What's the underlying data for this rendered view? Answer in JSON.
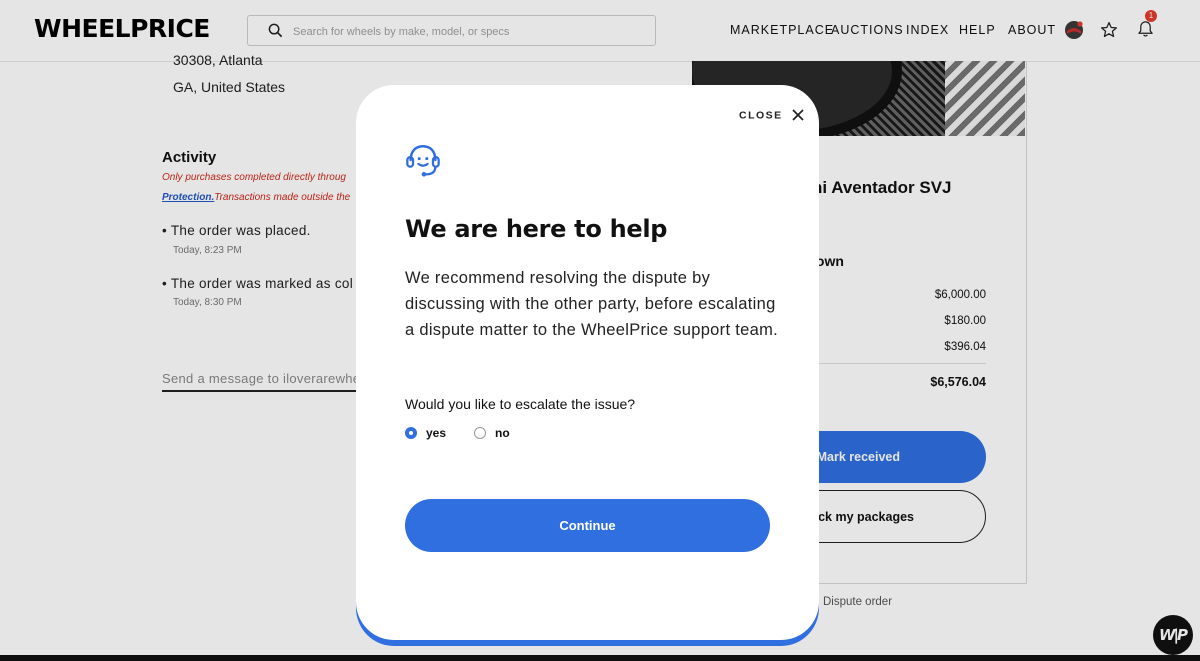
{
  "header": {
    "logo": "WHEELPRICE",
    "search_placeholder": "Search for wheels by make, model, or specs",
    "nav": [
      "MARKETPLACE",
      "AUCTIONS",
      "INDEX",
      "HELP",
      "ABOUT"
    ],
    "notification_count": "1"
  },
  "background": {
    "address_line1": "30308, Atlanta",
    "address_line2": "GA, United States",
    "activity_title": "Activity",
    "notice_line1": "Only purchases completed directly throug",
    "notice_link": "Protection.",
    "notice_line2": "Transactions made outside the",
    "events": [
      {
        "text": "• The order was placed.",
        "time": "Today, 8:23 PM"
      },
      {
        "text": "• The order was marked as col",
        "time": "Today, 8:30 PM"
      }
    ],
    "message_placeholder": "Send a message to iloverarewhe",
    "car_title": "ni Aventador SVJ",
    "breakdown_title": "lown",
    "prices": [
      "$6,000.00",
      "$180.00",
      "$396.04"
    ],
    "total": "$6,576.04",
    "mark_received": "Mark received",
    "track_packages": "ck my packages",
    "dispute": "Dispute order"
  },
  "modal": {
    "close_label": "CLOSE",
    "title": "We are here to help",
    "body": "We recommend resolving the dispute by discussing with the other party, before escalating a dispute matter to the WheelPrice support team.",
    "question": "Would you like to escalate the issue?",
    "options": [
      {
        "label": "yes",
        "selected": true
      },
      {
        "label": "no",
        "selected": false
      }
    ],
    "continue_label": "Continue"
  },
  "colors": {
    "accent": "#2f6fe0",
    "notice_red": "#d0261a",
    "badge_red": "#e23b2f"
  }
}
